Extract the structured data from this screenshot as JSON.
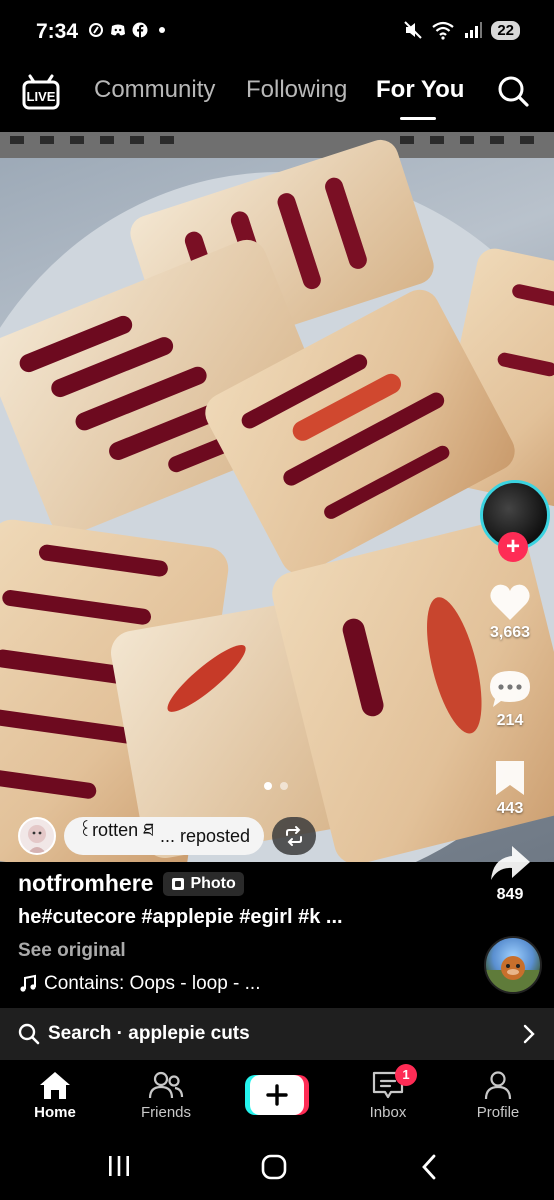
{
  "status_bar": {
    "time": "7:34",
    "battery": "22"
  },
  "top_nav": {
    "tabs": [
      {
        "label": "Community",
        "active": false
      },
      {
        "label": "Following",
        "active": false
      },
      {
        "label": "For You",
        "active": true
      }
    ]
  },
  "photo": {
    "page_count": 2,
    "active_page": 1
  },
  "repost": {
    "name": "꒰rotten ཐ",
    "label": "... reposted"
  },
  "post": {
    "username": "notfromhere",
    "type_badge": "Photo",
    "caption": "he#cutecore #applepie #egirl #k ...",
    "see_original": "See original",
    "sound": "Contains: Oops - loop - ..."
  },
  "actions": {
    "likes": "3,663",
    "comments": "214",
    "saves": "443",
    "shares": "849"
  },
  "search_bar": {
    "prefix": "Search · ",
    "query": "applepie cuts"
  },
  "tab_bar": {
    "home": "Home",
    "friends": "Friends",
    "inbox": "Inbox",
    "inbox_badge": "1",
    "profile": "Profile"
  },
  "colors": {
    "accent_red": "#fe2c55",
    "accent_cyan": "#25f4ee",
    "ring": "#3ad3e0"
  }
}
